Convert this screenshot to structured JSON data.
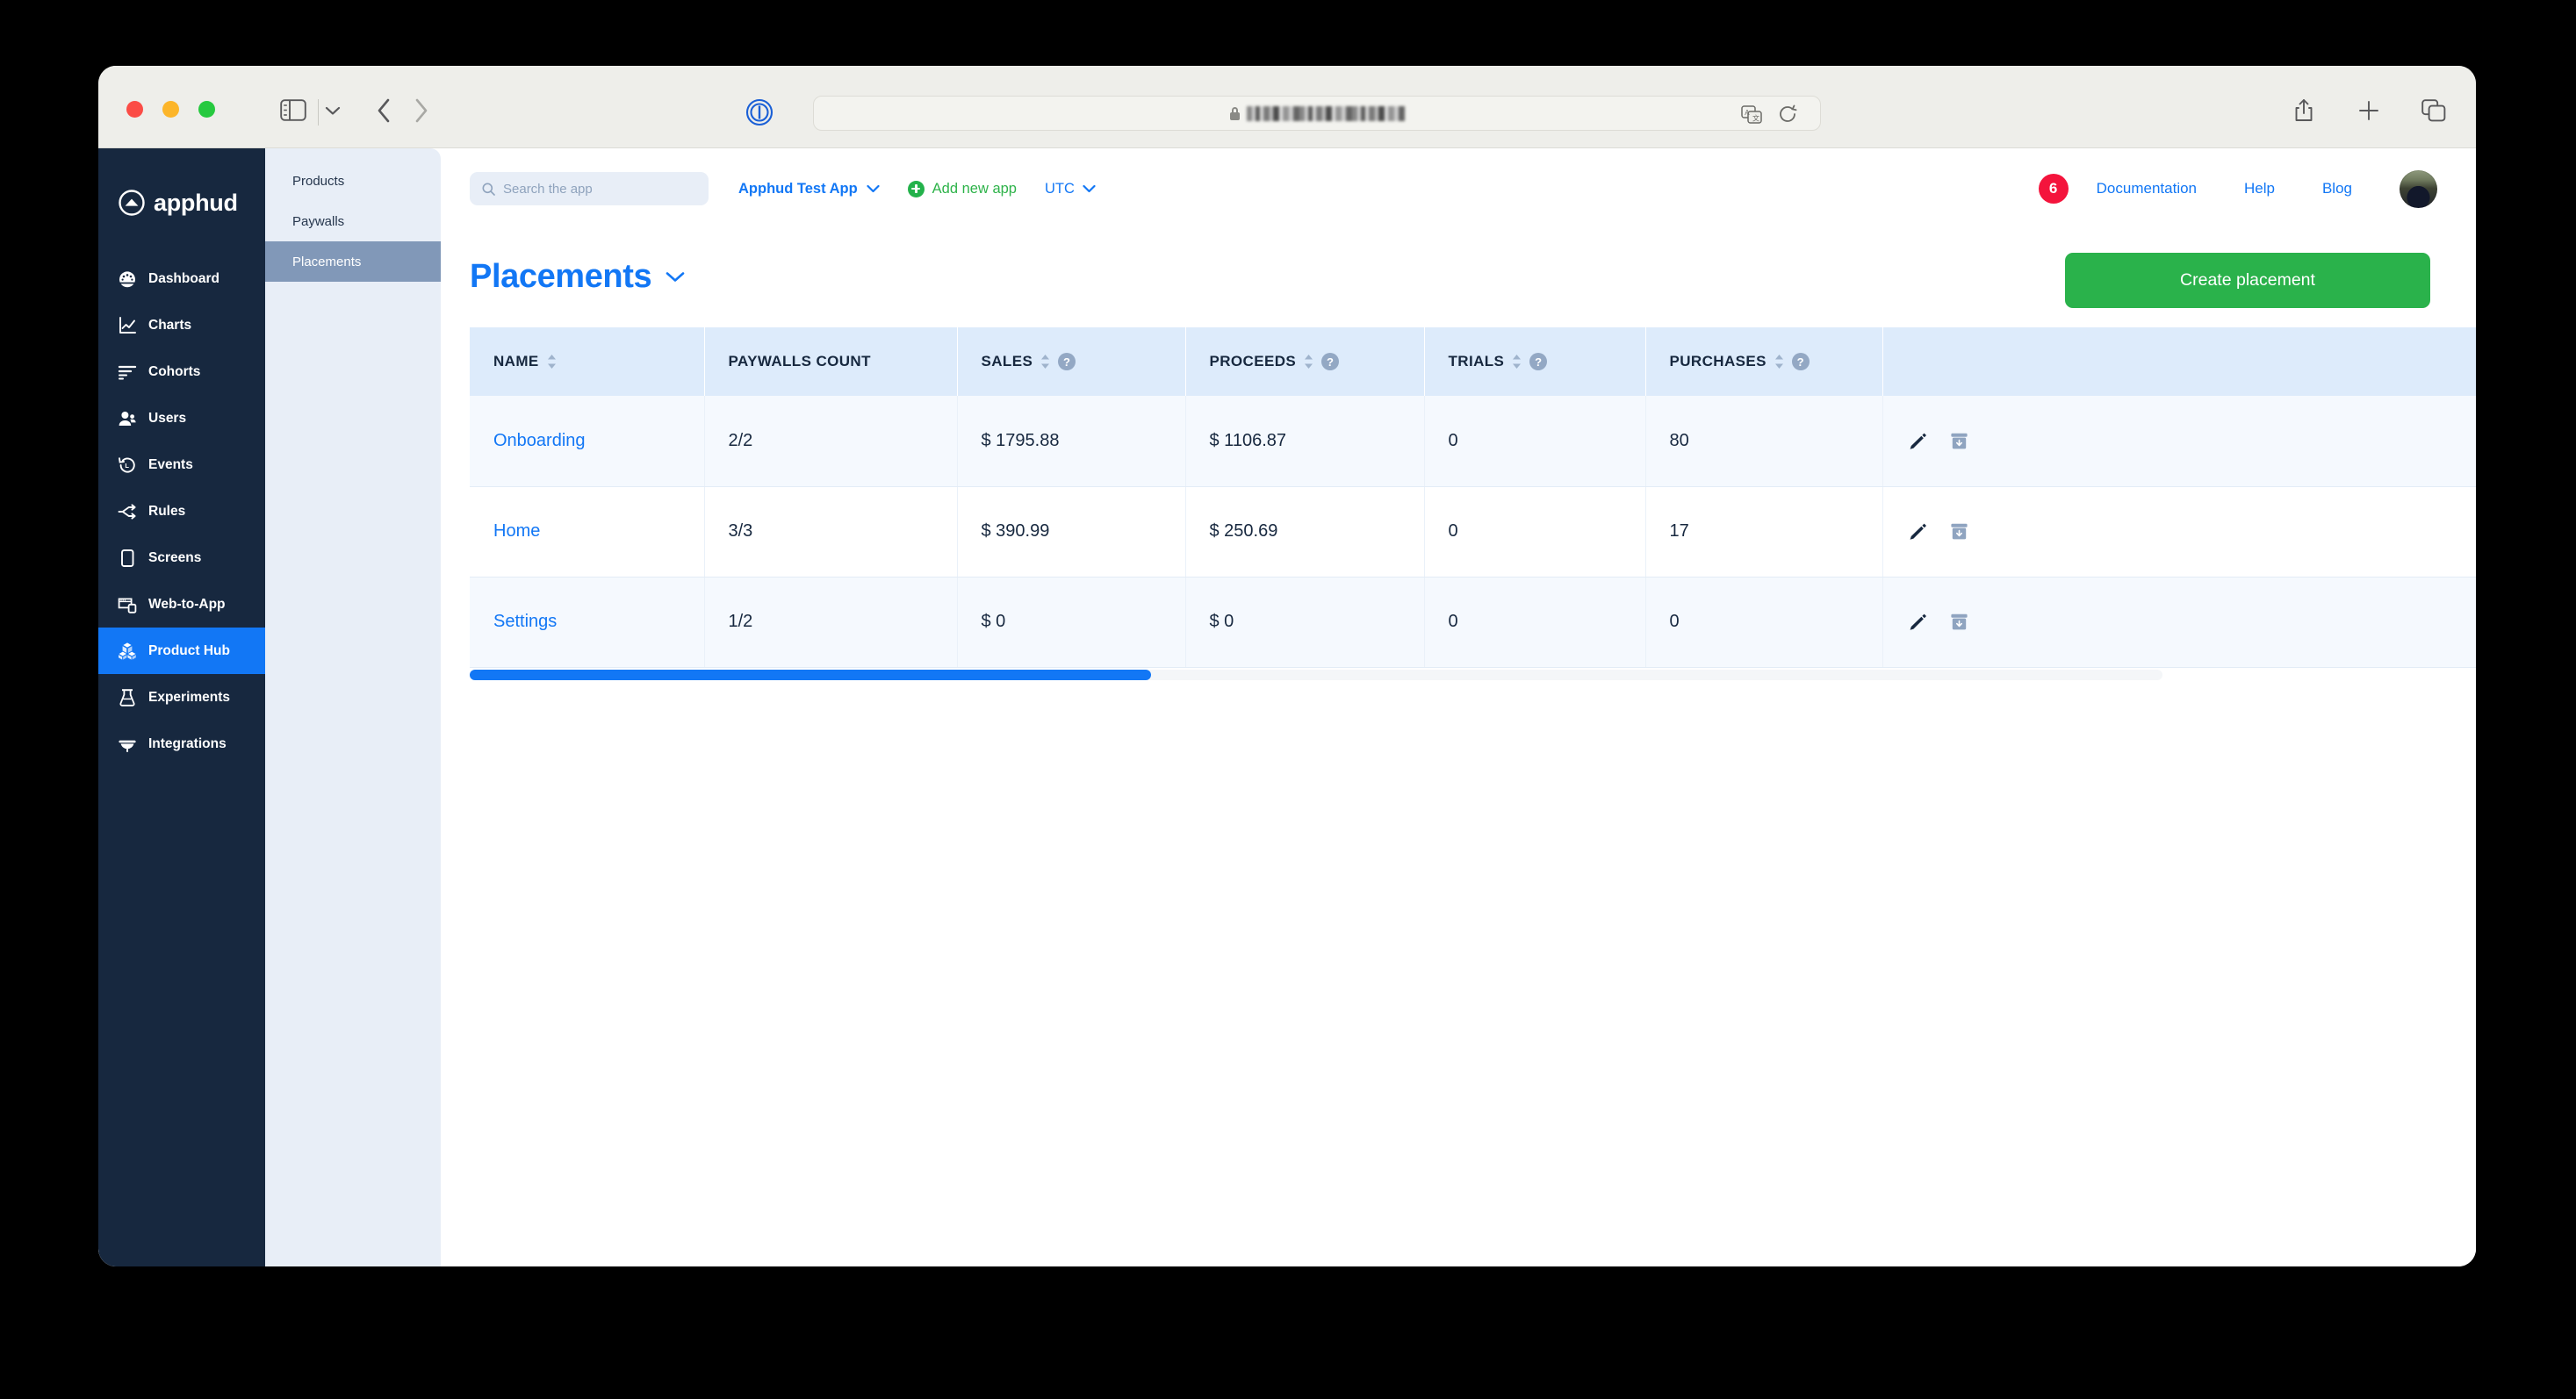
{
  "browser": {
    "traffic_lights": [
      "close",
      "minimize",
      "zoom"
    ],
    "url_text": "",
    "url_redacted": true,
    "icons": {
      "sidebar_toggle": "sidebar-toggle-icon",
      "tab_overview_chevron": "chevron-down-icon",
      "back": "back-arrow-icon",
      "forward": "forward-arrow-icon",
      "privacy_shield": "privacy-shield-icon",
      "lock": "lock-icon",
      "translate": "translate-icon",
      "reload": "reload-icon",
      "share": "share-icon",
      "new_tab": "plus-icon",
      "tab_overview": "tab-overview-icon"
    }
  },
  "sidebar": {
    "brand": "apphud",
    "items": [
      {
        "label": "Dashboard",
        "icon": "dashboard-icon",
        "active": false
      },
      {
        "label": "Charts",
        "icon": "charts-icon",
        "active": false
      },
      {
        "label": "Cohorts",
        "icon": "cohorts-icon",
        "active": false
      },
      {
        "label": "Users",
        "icon": "users-icon",
        "active": false
      },
      {
        "label": "Events",
        "icon": "events-icon",
        "active": false
      },
      {
        "label": "Rules",
        "icon": "rules-icon",
        "active": false
      },
      {
        "label": "Screens",
        "icon": "screens-icon",
        "active": false
      },
      {
        "label": "Web-to-App",
        "icon": "web-to-app-icon",
        "active": false
      },
      {
        "label": "Product Hub",
        "icon": "product-hub-icon",
        "active": true
      },
      {
        "label": "Experiments",
        "icon": "experiments-icon",
        "active": false
      },
      {
        "label": "Integrations",
        "icon": "integrations-icon",
        "active": false
      }
    ]
  },
  "subnav": {
    "items": [
      {
        "label": "Products",
        "active": false
      },
      {
        "label": "Paywalls",
        "active": false
      },
      {
        "label": "Placements",
        "active": true
      }
    ]
  },
  "topbar": {
    "search_placeholder": "Search the app",
    "search_value": "",
    "app_selector": "Apphud Test App",
    "add_new_app": "Add new app",
    "timezone": "UTC",
    "notification_count": "6",
    "links": [
      "Documentation",
      "Help",
      "Blog"
    ]
  },
  "page": {
    "title": "Placements",
    "create_button": "Create placement"
  },
  "table": {
    "columns": [
      {
        "label": "NAME",
        "sortable": true,
        "help": false
      },
      {
        "label": "PAYWALLS COUNT",
        "sortable": false,
        "help": false
      },
      {
        "label": "SALES",
        "sortable": true,
        "help": true
      },
      {
        "label": "PROCEEDS",
        "sortable": true,
        "help": true
      },
      {
        "label": "TRIALS",
        "sortable": true,
        "help": true
      },
      {
        "label": "PURCHASES",
        "sortable": true,
        "help": true
      },
      {
        "label": "",
        "sortable": false,
        "help": false
      }
    ],
    "rows": [
      {
        "name": "Onboarding",
        "paywalls_count": "2/2",
        "sales": "$ 1795.88",
        "proceeds": "$ 1106.87",
        "trials": "0",
        "purchases": "80"
      },
      {
        "name": "Home",
        "paywalls_count": "3/3",
        "sales": "$ 390.99",
        "proceeds": "$ 250.69",
        "trials": "0",
        "purchases": "17"
      },
      {
        "name": "Settings",
        "paywalls_count": "1/2",
        "sales": "$ 0",
        "proceeds": "$ 0",
        "trials": "0",
        "purchases": "0"
      }
    ],
    "row_actions": [
      "edit-icon",
      "archive-icon"
    ],
    "scroll_position_percent": 40
  },
  "colors": {
    "sidebar_bg": "#17283f",
    "accent_blue": "#1277f5",
    "accent_green": "#2ab24b",
    "badge_red": "#f4143c",
    "subnav_bg": "#e8eef7",
    "subnav_active": "#8198b8",
    "table_header_bg": "#ddebfb",
    "row_alt_bg": "#f5f9fe"
  }
}
